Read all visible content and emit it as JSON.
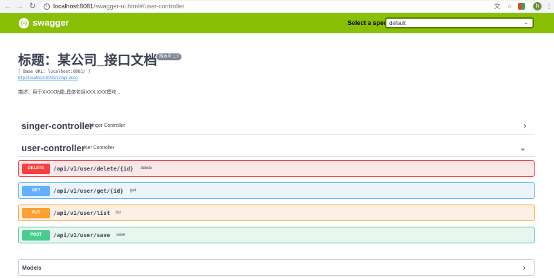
{
  "browser": {
    "back_icon": "back-arrow-icon",
    "forward_icon": "forward-arrow-icon",
    "reload_icon": "reload-icon",
    "url_host": "localhost:8081",
    "url_path": "/swagger-ui.html#/user-controller",
    "avatar_letter": "h"
  },
  "topbar": {
    "logo_text": "swagger",
    "spec_label": "Select a spec",
    "spec_value": "default"
  },
  "info": {
    "title": "标题：某公司_接口文档",
    "version": "版本号:1.0",
    "base_url": "[ Base URL: localhost:8081/ ]",
    "docs_link": "http://localhost:8081/v2/api-docs",
    "description": "描述：用于XXXX功能,具体包括XXX,XXX模块..."
  },
  "tags": [
    {
      "name": "singer-controller",
      "description": "Singer Controller",
      "expanded": false
    },
    {
      "name": "user-controller",
      "description": "User Controller",
      "expanded": true
    }
  ],
  "operations": [
    {
      "method": "DELETE",
      "path": "/api/v1/user/delete/{id}",
      "summary": "delete",
      "color": "#f93e3e"
    },
    {
      "method": "GET",
      "path": "/api/v1/user/get/{id}",
      "summary": "get",
      "color": "#61affe"
    },
    {
      "method": "PUT",
      "path": "/api/v1/user/list",
      "summary": "list",
      "color": "#fca130"
    },
    {
      "method": "POST",
      "path": "/api/v1/user/save",
      "summary": "save",
      "color": "#49cc90"
    }
  ],
  "models": {
    "label": "Models"
  },
  "colors": {
    "topbar": "#89bf04",
    "text": "#3b4151",
    "link": "#4990e2"
  }
}
